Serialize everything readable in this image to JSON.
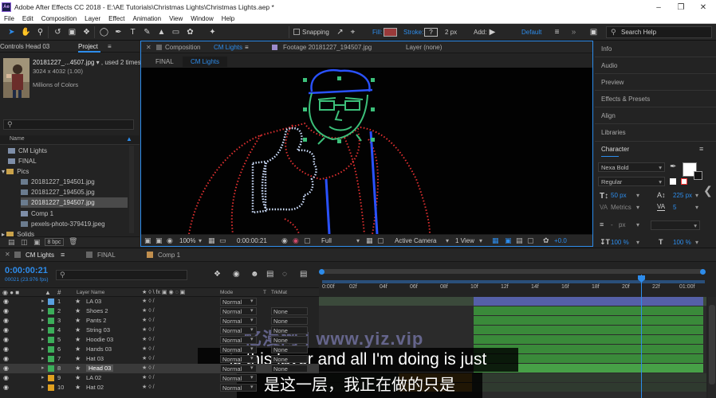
{
  "app": {
    "window_title": "Adobe After Effects CC 2018 - E:\\AE Tutorials\\Christmas Lights\\Christmas Lights.aep *",
    "menus": [
      "File",
      "Edit",
      "Composition",
      "Layer",
      "Effect",
      "Animation",
      "View",
      "Window",
      "Help"
    ]
  },
  "toolbar": {
    "snapping_label": "Snapping",
    "fill_label": "Fill:",
    "stroke_label": "Stroke:",
    "stroke_width": "2 px",
    "add_label": "Add:",
    "workspace": "Default",
    "search_placeholder": "Search Help"
  },
  "project_panel": {
    "effect_controls_tab": "Controls Head 03",
    "project_tab": "Project",
    "footage_name": "20181227_...4507.jpg",
    "footage_used": ", used 2 times",
    "footage_size": "3024 x 4032 (1.00)",
    "footage_colors": "Millions of Colors",
    "name_header": "Name",
    "bpc": "8 bpc",
    "items": [
      "CM Lights",
      "FINAL",
      "Pics",
      "20181227_194501.jpg",
      "20181227_194505.jpg",
      "20181227_194507.jpg",
      "Comp 1",
      "pexels-photo-379419.jpeg",
      "Solids"
    ]
  },
  "viewer": {
    "comp_tab_prefix": "Composition",
    "comp_tab_name": "CM Lights",
    "footage_tab": "Footage 20181227_194507.jpg",
    "layer_tab": "Layer (none)",
    "crumb_final": "FINAL",
    "crumb_cm": "CM Lights",
    "zoom": "100%",
    "timecode": "0:00:00:21",
    "resolution": "Full",
    "camera": "Active Camera",
    "views": "1 View",
    "exposure": "+0.0"
  },
  "right_panel": {
    "items": [
      "Info",
      "Audio",
      "Preview",
      "Effects & Presets",
      "Align",
      "Libraries"
    ],
    "character_title": "Character",
    "font": "Nexa Bold",
    "style": "Regular",
    "font_size": "50 px",
    "leading": "225 px",
    "kerning": "Metrics",
    "tracking": "5",
    "stroke_unit": "px",
    "vscale": "100 %",
    "hscale": "100 %"
  },
  "timeline": {
    "tabs": [
      "CM Lights",
      "FINAL",
      "Comp 1"
    ],
    "timecode": "0:00:00:21",
    "fps_info": "00021 (23.976 fps)",
    "col_layer_name": "Layer Name",
    "col_mode": "Mode",
    "col_t": "T",
    "col_trkmat": "TrkMat",
    "ruler": [
      "0:00f",
      "02f",
      "04f",
      "06f",
      "08f",
      "10f",
      "12f",
      "14f",
      "16f",
      "18f",
      "20f",
      "22f",
      "01:00f"
    ],
    "layers": [
      {
        "num": "1",
        "name": "LA 03",
        "mode": "Normal",
        "trkmat": "",
        "color": "#5aa0e0"
      },
      {
        "num": "2",
        "name": "Shoes 2",
        "mode": "Normal",
        "trkmat": "None",
        "color": "#3cae5a"
      },
      {
        "num": "3",
        "name": "Pants 2",
        "mode": "Normal",
        "trkmat": "None",
        "color": "#3cae5a"
      },
      {
        "num": "4",
        "name": "String 03",
        "mode": "Normal",
        "trkmat": "None",
        "color": "#3cae5a"
      },
      {
        "num": "5",
        "name": "Hoodie 03",
        "mode": "Normal",
        "trkmat": "None",
        "color": "#3cae5a"
      },
      {
        "num": "6",
        "name": "Hands 03",
        "mode": "Normal",
        "trkmat": "None",
        "color": "#3cae5a"
      },
      {
        "num": "7",
        "name": "Hat 03",
        "mode": "Normal",
        "trkmat": "None",
        "color": "#3cae5a"
      },
      {
        "num": "8",
        "name": "Head 03",
        "mode": "Normal",
        "trkmat": "None",
        "color": "#3cae5a"
      },
      {
        "num": "9",
        "name": "LA 02",
        "mode": "Normal",
        "trkmat": "",
        "color": "#e0a020"
      },
      {
        "num": "10",
        "name": "Hat 02",
        "mode": "Normal",
        "trkmat": "",
        "color": "#e0a020"
      }
    ]
  },
  "overlay": {
    "watermark": "忆漫网 | www.yiz.vip",
    "subtitle_en": "is this layer and all I'm doing is just",
    "subtitle_zh": "是这一层，我正在做的只是"
  },
  "colors": {
    "accent_blue": "#2d8ceb",
    "bar_green": "#3a8a3a",
    "bar_purple": "#5560a8",
    "bar_orange": "#b07a20"
  }
}
